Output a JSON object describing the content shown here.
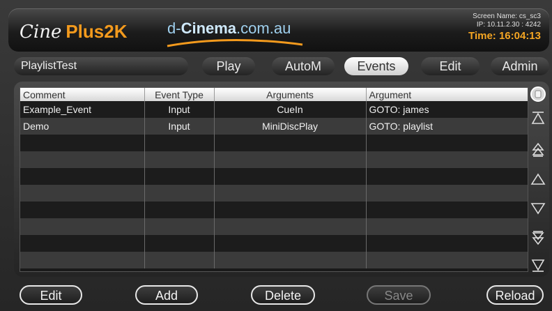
{
  "header": {
    "logo_cine": "Cine",
    "logo_plus": "Plus2K",
    "brand_prefix": "d-",
    "brand_main": "Cinema",
    "brand_suffix": ".com.au",
    "screen_name": "Screen Name: cs_sc3",
    "ip": "IP: 10.11.2.30 : 4242",
    "time": "Time: 16:04:13"
  },
  "nav": {
    "playlist_name": "PlaylistTest",
    "tabs": [
      {
        "label": "Play"
      },
      {
        "label": "AutoM"
      },
      {
        "label": "Events"
      },
      {
        "label": "Edit"
      },
      {
        "label": "Admin"
      }
    ],
    "active_tab": "Events"
  },
  "table": {
    "columns": [
      "Comment",
      "Event Type",
      "Arguments",
      "Argument"
    ],
    "rows": [
      [
        "Example_Event",
        "Input",
        "CueIn",
        "GOTO: james"
      ],
      [
        "Demo",
        "Input",
        "MiniDiscPlay",
        "GOTO: playlist"
      ],
      [
        "",
        "",
        "",
        ""
      ],
      [
        "",
        "",
        "",
        ""
      ],
      [
        "",
        "",
        "",
        ""
      ],
      [
        "",
        "",
        "",
        ""
      ],
      [
        "",
        "",
        "",
        ""
      ],
      [
        "",
        "",
        "",
        ""
      ],
      [
        "",
        "",
        "",
        ""
      ],
      [
        "",
        "",
        "",
        ""
      ]
    ]
  },
  "buttons": {
    "edit": "Edit",
    "add": "Add",
    "delete": "Delete",
    "save": "Save",
    "reload": "Reload"
  },
  "colors": {
    "accent": "#f5a623",
    "brand": "#9fd0ee"
  }
}
